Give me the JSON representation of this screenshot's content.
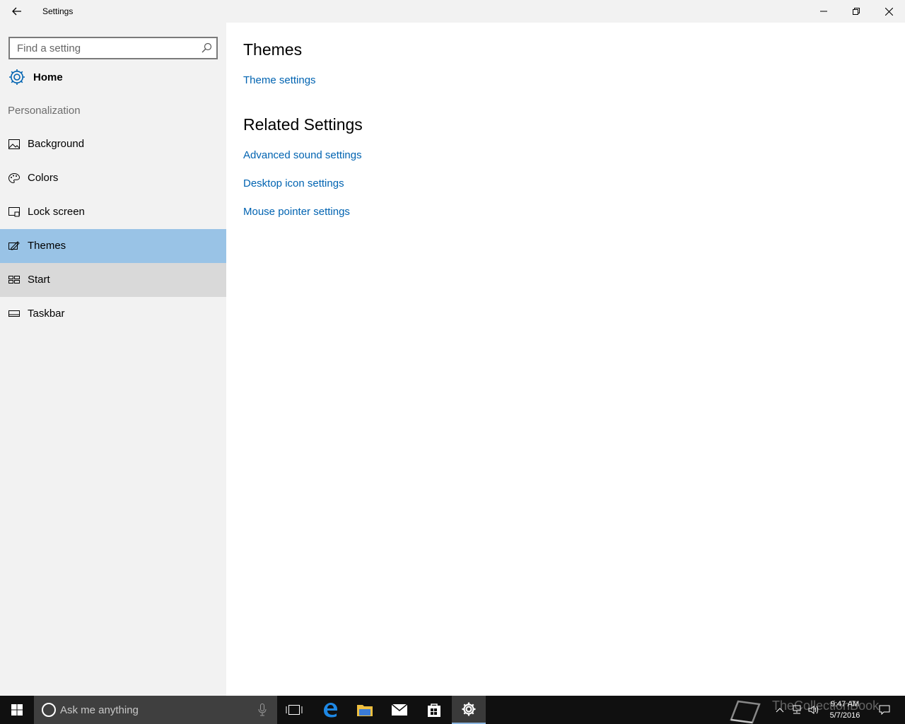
{
  "window": {
    "title": "Settings"
  },
  "sidebar": {
    "search_placeholder": "Find a setting",
    "home_label": "Home",
    "section_label": "Personalization",
    "items": [
      {
        "label": "Background",
        "icon": "picture-icon"
      },
      {
        "label": "Colors",
        "icon": "palette-icon"
      },
      {
        "label": "Lock screen",
        "icon": "lock-screen-icon"
      },
      {
        "label": "Themes",
        "icon": "themes-icon",
        "state": "selected"
      },
      {
        "label": "Start",
        "icon": "start-icon",
        "state": "hover"
      },
      {
        "label": "Taskbar",
        "icon": "taskbar-icon"
      }
    ]
  },
  "main": {
    "heading": "Themes",
    "theme_link": "Theme settings",
    "related_heading": "Related Settings",
    "related_links": [
      "Advanced sound settings",
      "Desktop icon settings",
      "Mouse pointer settings"
    ]
  },
  "taskbar": {
    "search_placeholder": "Ask me anything",
    "time": "9:47 AM",
    "date": "5/7/2016",
    "watermark": "TheCollectionBook"
  },
  "colors": {
    "accent_link": "#0063b1",
    "selected_item": "#99c3e6",
    "hover_item": "#d9d9d9",
    "sidebar_bg": "#f2f2f2",
    "taskbar_bg": "#101010",
    "edge_blue": "#1e88e5"
  }
}
